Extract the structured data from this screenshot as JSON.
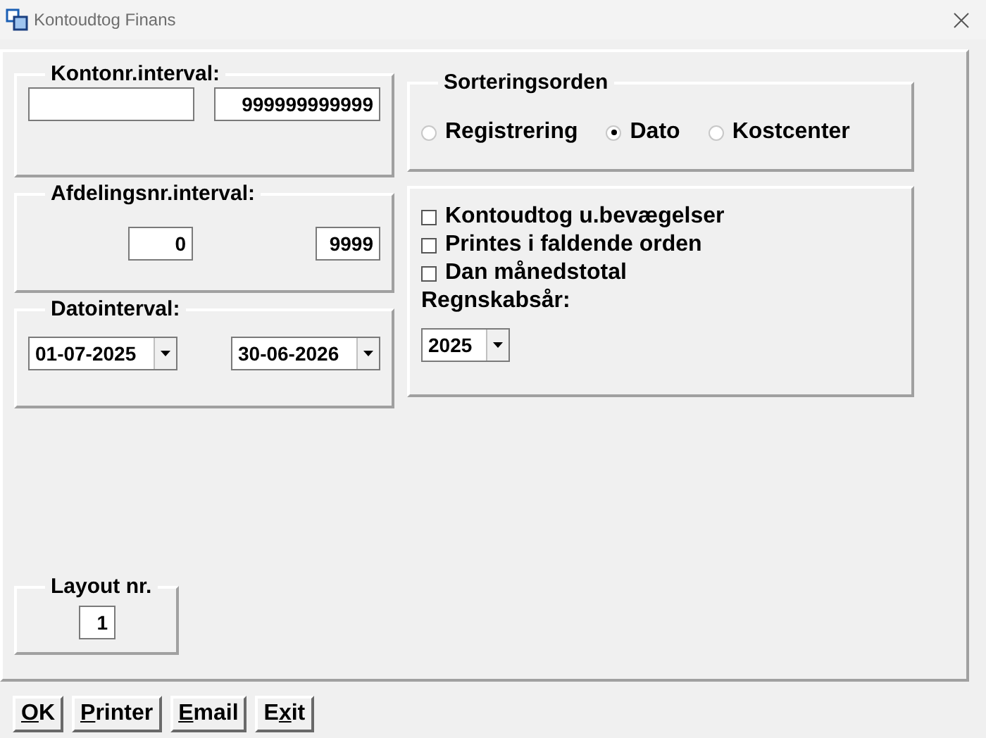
{
  "window": {
    "title": "Kontoudtog Finans"
  },
  "account_interval": {
    "title": "Kontonr.interval:",
    "to": "999999999999"
  },
  "department_interval": {
    "title": "Afdelingsnr.interval:",
    "from": "0",
    "to": "9999"
  },
  "date_interval": {
    "title": "Datointerval:",
    "from": "01-07-2025",
    "to": "30-06-2026"
  },
  "sort_order": {
    "title": "Sorteringsorden",
    "options": [
      {
        "label": "Registrering",
        "selected": false
      },
      {
        "label": "Dato",
        "selected": true
      },
      {
        "label": "Kostcenter",
        "selected": false
      }
    ]
  },
  "options": {
    "checkboxes": [
      {
        "label": "Kontoudtog u.bevægelser",
        "checked": false
      },
      {
        "label": "Printes i faldende orden",
        "checked": false
      },
      {
        "label": "Dan månedstotal",
        "checked": false
      }
    ],
    "fiscal_year_label": "Regnskabsår:",
    "fiscal_year": "2025"
  },
  "layout": {
    "title": "Layout nr.",
    "value": "1"
  },
  "buttons": [
    {
      "mnemonic": "O",
      "after": "K"
    },
    {
      "mnemonic": "P",
      "after": "rinter"
    },
    {
      "mnemonic": "E",
      "after": "mail"
    },
    {
      "before": "E",
      "mnemonic": "x",
      "after": "it"
    }
  ]
}
